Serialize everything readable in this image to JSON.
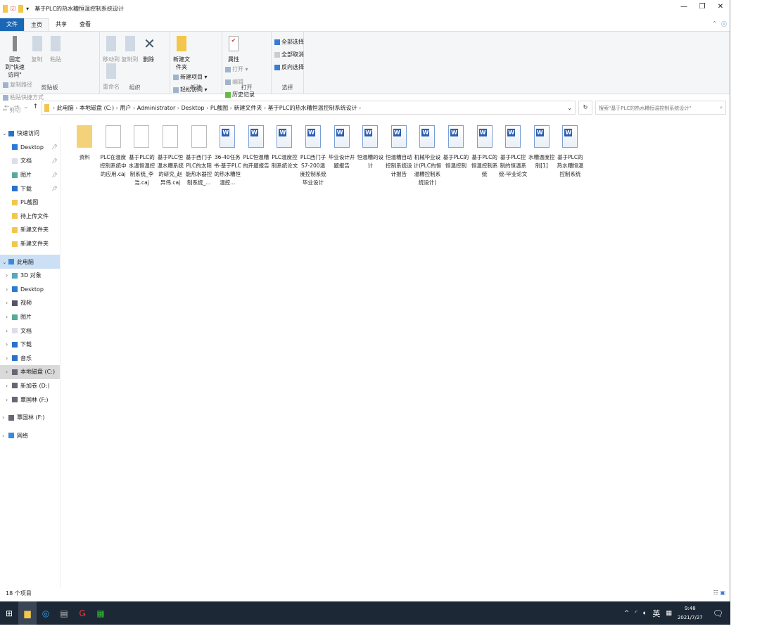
{
  "window": {
    "title": "基于PLC的热水糟恒温控制系统设计",
    "controls": [
      "—",
      "❐",
      "✕"
    ]
  },
  "tabs": [
    "文件",
    "主页",
    "共享",
    "查看"
  ],
  "ribbon": {
    "clipboard": {
      "pin": "固定到\"快速访问\"",
      "copy": "复制",
      "paste": "粘贴",
      "copy_path": "复制路径",
      "paste_shortcut": "粘贴快捷方式",
      "cut": "剪切",
      "label": "剪贴板"
    },
    "organize": {
      "move_to": "移动到",
      "copy_to": "复制到",
      "delete": "删除",
      "rename": "重命名",
      "label": "组织"
    },
    "new": {
      "new_folder": "新建文件夹",
      "new_item": "新建项目 ▾",
      "easy_access": "轻松访问 ▾",
      "label": "新建"
    },
    "open": {
      "properties": "属性",
      "open": "打开 ▾",
      "edit": "编辑",
      "history": "历史记录",
      "label": "打开"
    },
    "select": {
      "select_all": "全部选择",
      "select_none": "全部取消",
      "invert": "反向选择",
      "label": "选择"
    }
  },
  "address": {
    "path": [
      "此电脑",
      "本地磁盘 (C:)",
      "用户",
      "Administrator",
      "Desktop",
      "PL截图",
      "新建文件夹",
      "基于PLC的热水糟恒温控制系统设计"
    ],
    "search_placeholder": "搜索\"基于PLC的热水糟恒温控制系统设计\""
  },
  "sidebar": [
    {
      "label": "快速访问",
      "level": 0,
      "icon": "star-icon"
    },
    {
      "label": "Desktop",
      "level": 1,
      "pin": true,
      "icon": "desktop-icon"
    },
    {
      "label": "文档",
      "level": 1,
      "pin": true,
      "icon": "documents-icon"
    },
    {
      "label": "图片",
      "level": 1,
      "pin": true,
      "icon": "pictures-icon"
    },
    {
      "label": "下载",
      "level": 1,
      "pin": true,
      "icon": "download-icon"
    },
    {
      "label": "PL截图",
      "level": 1,
      "icon": "folder-icon"
    },
    {
      "label": "待上传文件",
      "level": 1,
      "icon": "folder-icon"
    },
    {
      "label": "新建文件夹",
      "level": 1,
      "icon": "folder-icon"
    },
    {
      "label": "新建文件夹",
      "level": 1,
      "icon": "folder-icon"
    },
    {
      "label": "此电脑",
      "level": 0,
      "icon": "computer-icon",
      "selected": true
    },
    {
      "label": "3D 对象",
      "level": 1,
      "icon": "3d-objects-icon"
    },
    {
      "label": "Desktop",
      "level": 1,
      "icon": "desktop-icon"
    },
    {
      "label": "视频",
      "level": 1,
      "icon": "videos-icon"
    },
    {
      "label": "图片",
      "level": 1,
      "icon": "pictures-icon"
    },
    {
      "label": "文档",
      "level": 1,
      "icon": "documents-icon"
    },
    {
      "label": "下载",
      "level": 1,
      "icon": "download-icon"
    },
    {
      "label": "音乐",
      "level": 1,
      "icon": "music-icon"
    },
    {
      "label": "本地磁盘 (C:)",
      "level": 1,
      "icon": "drive-icon",
      "highlight": true
    },
    {
      "label": "新加卷 (D:)",
      "level": 1,
      "icon": "drive-icon"
    },
    {
      "label": "覃国林 (F:)",
      "level": 1,
      "icon": "drive-icon"
    },
    {
      "label": "覃国林 (F:)",
      "level": 0,
      "icon": "drive-icon"
    },
    {
      "label": "网络",
      "level": 0,
      "icon": "network-icon"
    }
  ],
  "files": [
    {
      "name": "资料",
      "type": "folder"
    },
    {
      "name": "PLC在温度控制系统中的应用.caj",
      "type": "caj"
    },
    {
      "name": "基于PLC的水温恒温控制系统_李浩.caj",
      "type": "caj"
    },
    {
      "name": "基于PLC恒温水糟系统的研究_赵异伟.caj",
      "type": "caj"
    },
    {
      "name": "基于西门子PLC的太阳能热水器控制系统_...",
      "type": "caj"
    },
    {
      "name": "36-40任务书-基于PLC的热水糟恒温控...",
      "type": "word"
    },
    {
      "name": "PLC恒温糟的开题报告",
      "type": "word"
    },
    {
      "name": "PLC温度控制系统论文",
      "type": "word"
    },
    {
      "name": "PLC西门子S7-200温度控制系统毕业设计",
      "type": "word"
    },
    {
      "name": "毕业设计开题报告",
      "type": "word"
    },
    {
      "name": "恒温糟的设计",
      "type": "word"
    },
    {
      "name": "恒温糟自动控制系统设计报告",
      "type": "word"
    },
    {
      "name": "机械毕业设计(PLC的恒温糟控制系统设计)",
      "type": "word"
    },
    {
      "name": "基于PLC的恒温控制",
      "type": "word"
    },
    {
      "name": "基于PLC的恒温控制系统",
      "type": "word"
    },
    {
      "name": "基于PLC控制的恒温系统-毕业论文",
      "type": "word"
    },
    {
      "name": "水糟温度控制[1]",
      "type": "word"
    },
    {
      "name": "基于PLC的热水糟恒温控制系统",
      "type": "word"
    }
  ],
  "status": {
    "count": "18 个项目"
  },
  "taskbar": {
    "apps": [
      "start-icon",
      "file-explorer-icon",
      "browser-icon",
      "app-icon",
      "wps-icon",
      "excel-icon"
    ],
    "tray": {
      "chevron": "^",
      "ime": "英",
      "time": "9:48",
      "date": "2021/7/27"
    }
  }
}
